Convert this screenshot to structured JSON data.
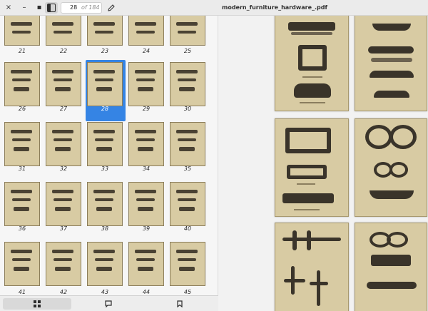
{
  "window": {
    "title": "modern_furniture_hardware_.pdf",
    "close_glyph": "×",
    "minimize_glyph": "–",
    "maximize_glyph": "▪"
  },
  "toolbar": {
    "current_page": "28",
    "page_count_label": "of 184",
    "sidebar_toggle_icon": "sidebar-icon",
    "annotate_icon": "pencil-icon"
  },
  "sidebar": {
    "thumbnail_pages": [
      "21",
      "22",
      "23",
      "24",
      "25",
      "26",
      "27",
      "28",
      "29",
      "30",
      "31",
      "32",
      "33",
      "34",
      "35",
      "36",
      "37",
      "38",
      "39",
      "40",
      "41",
      "42",
      "43",
      "44",
      "45"
    ],
    "selected_page": "28",
    "tabs": [
      {
        "name": "thumbnails",
        "icon": "grid-icon",
        "active": true
      },
      {
        "name": "annotations",
        "icon": "comment-icon",
        "active": false
      },
      {
        "name": "bookmarks",
        "icon": "bookmark-icon",
        "active": false
      }
    ]
  },
  "colors": {
    "accent": "#3584e4",
    "paper": "#d8cba3",
    "ink": "#3a342a"
  }
}
